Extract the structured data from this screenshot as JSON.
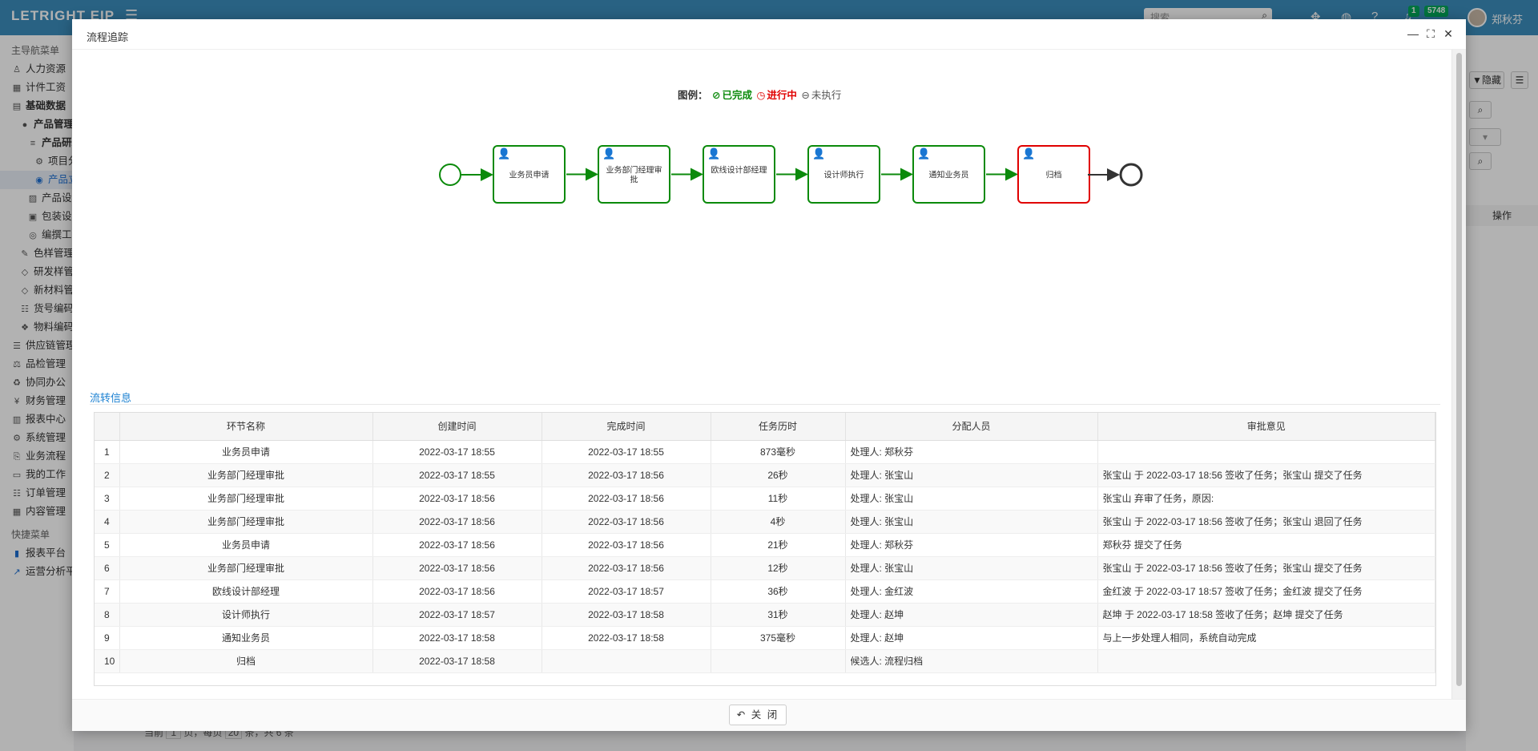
{
  "app": {
    "brand": "LETRIGHT EIP",
    "search_placeholder": "搜索",
    "notification_count": "1",
    "message_count": "5748",
    "username": "郑秋芬"
  },
  "sidebar": {
    "main_menu_title": "主导航菜单",
    "quick_menu_title": "快捷菜单",
    "items": [
      {
        "label": "人力资源",
        "icon": "user-icon"
      },
      {
        "label": "计件工资",
        "icon": "calculator-icon"
      },
      {
        "label": "基础数据",
        "icon": "grid-icon"
      },
      {
        "label": "产品管理",
        "icon": "p-circle-icon"
      },
      {
        "label": "产品研发",
        "icon": "list-icon"
      },
      {
        "label": "项目分类",
        "icon": "gears-icon"
      },
      {
        "label": "产品立项",
        "icon": "eye-icon"
      },
      {
        "label": "产品设计",
        "icon": "image-icon"
      },
      {
        "label": "包装设计",
        "icon": "gift-icon"
      },
      {
        "label": "编撰工艺",
        "icon": "compass-icon"
      },
      {
        "label": "色样管理",
        "icon": "brush-icon"
      },
      {
        "label": "研发样管理",
        "icon": "tag-icon"
      },
      {
        "label": "新材料管理",
        "icon": "tag-icon"
      },
      {
        "label": "货号编码",
        "icon": "sitemap-icon"
      },
      {
        "label": "物料编码",
        "icon": "cubes-icon"
      },
      {
        "label": "供应链管理",
        "icon": "tasks-icon"
      },
      {
        "label": "品检管理",
        "icon": "balance-icon"
      },
      {
        "label": "协同办公",
        "icon": "recycle-icon"
      },
      {
        "label": "财务管理",
        "icon": "yen-icon"
      },
      {
        "label": "报表中心",
        "icon": "report-icon"
      },
      {
        "label": "系统管理",
        "icon": "cog-icon"
      },
      {
        "label": "业务流程",
        "icon": "flow-icon"
      },
      {
        "label": "我的工作",
        "icon": "desktop-icon"
      },
      {
        "label": "订单管理",
        "icon": "order-icon"
      },
      {
        "label": "内容管理",
        "icon": "content-icon"
      }
    ],
    "quick_items": [
      {
        "label": "报表平台",
        "icon": "bar-chart-icon"
      },
      {
        "label": "运营分析平台",
        "icon": "line-chart-icon"
      }
    ]
  },
  "right_panel": {
    "hide_label": "隐藏",
    "operation_header": "操作"
  },
  "pager": {
    "text_current": "当前",
    "page": "1",
    "text_page": "页，每页",
    "per_page": "20",
    "text_total": "条，共 6 条"
  },
  "modal": {
    "title": "流程追踪",
    "legend": {
      "title": "图例：",
      "done": "已完成",
      "running": "进行中",
      "pending": "未执行"
    },
    "flow_nodes": [
      {
        "label": "业务员申请",
        "status": "done"
      },
      {
        "label": "业务部门经理审批",
        "status": "done"
      },
      {
        "label": "欧线设计部经理",
        "status": "done"
      },
      {
        "label": "设计师执行",
        "status": "done"
      },
      {
        "label": "通知业务员",
        "status": "done"
      },
      {
        "label": "归档",
        "status": "running"
      }
    ],
    "colors": {
      "done": "#0b8a0b",
      "running": "#e00000",
      "pending": "#666666"
    },
    "section_title": "流转信息",
    "table": {
      "headers": [
        "",
        "环节名称",
        "创建时间",
        "完成时间",
        "任务历时",
        "分配人员",
        "审批意见"
      ],
      "rows": [
        [
          "1",
          "业务员申请",
          "2022-03-17 18:55",
          "2022-03-17 18:55",
          "873毫秒",
          "处理人: 郑秋芬",
          ""
        ],
        [
          "2",
          "业务部门经理审批",
          "2022-03-17 18:55",
          "2022-03-17 18:56",
          "26秒",
          "处理人: 张宝山",
          "张宝山 于 2022-03-17 18:56 签收了任务；张宝山 提交了任务"
        ],
        [
          "3",
          "业务部门经理审批",
          "2022-03-17 18:56",
          "2022-03-17 18:56",
          "11秒",
          "处理人: 张宝山",
          "张宝山 弃审了任务，原因:"
        ],
        [
          "4",
          "业务部门经理审批",
          "2022-03-17 18:56",
          "2022-03-17 18:56",
          "4秒",
          "处理人: 张宝山",
          "张宝山 于 2022-03-17 18:56 签收了任务；张宝山 退回了任务"
        ],
        [
          "5",
          "业务员申请",
          "2022-03-17 18:56",
          "2022-03-17 18:56",
          "21秒",
          "处理人: 郑秋芬",
          "郑秋芬 提交了任务"
        ],
        [
          "6",
          "业务部门经理审批",
          "2022-03-17 18:56",
          "2022-03-17 18:56",
          "12秒",
          "处理人: 张宝山",
          "张宝山 于 2022-03-17 18:56 签收了任务；张宝山 提交了任务"
        ],
        [
          "7",
          "欧线设计部经理",
          "2022-03-17 18:56",
          "2022-03-17 18:57",
          "36秒",
          "处理人: 金红波",
          "金红波 于 2022-03-17 18:57 签收了任务；金红波 提交了任务"
        ],
        [
          "8",
          "设计师执行",
          "2022-03-17 18:57",
          "2022-03-17 18:58",
          "31秒",
          "处理人: 赵坤",
          "赵坤 于 2022-03-17 18:58 签收了任务；赵坤 提交了任务"
        ],
        [
          "9",
          "通知业务员",
          "2022-03-17 18:58",
          "2022-03-17 18:58",
          "375毫秒",
          "处理人: 赵坤",
          "与上一步处理人相同，系统自动完成"
        ],
        [
          "10",
          "归档",
          "2022-03-17 18:58",
          "",
          "",
          "候选人: 流程归档",
          ""
        ]
      ]
    },
    "close_label": "关 闭"
  }
}
